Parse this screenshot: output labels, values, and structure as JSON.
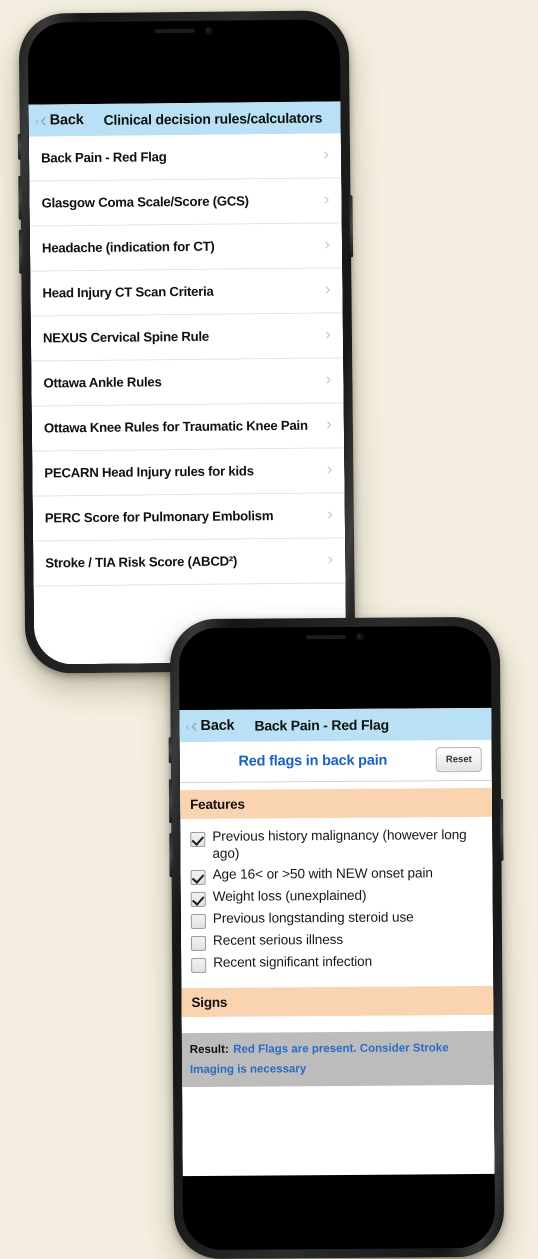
{
  "background_color": "#f4efe0",
  "accent_colors": {
    "navbar_blue": "#b9e0f5",
    "section_header_peach": "#fad3b0",
    "title_blue": "#1a5fc4",
    "result_bar_gray": "#bcbcbc",
    "result_text_blue": "#2a6ac4"
  },
  "phone1": {
    "navbar": {
      "back_label": "Back",
      "back_chevron_icon": "chevron-left-icon",
      "title": "Clinical decision rules/calculators"
    },
    "list": [
      {
        "label": "Back Pain - Red Flag",
        "chevron_icon": "chevron-right-icon"
      },
      {
        "label": "Glasgow Coma Scale/Score (GCS)",
        "chevron_icon": "chevron-right-icon"
      },
      {
        "label": "Headache (indication for CT)",
        "chevron_icon": "chevron-right-icon"
      },
      {
        "label": "Head Injury CT Scan Criteria",
        "chevron_icon": "chevron-right-icon"
      },
      {
        "label": "NEXUS Cervical Spine Rule",
        "chevron_icon": "chevron-right-icon"
      },
      {
        "label": "Ottawa Ankle Rules",
        "chevron_icon": "chevron-right-icon"
      },
      {
        "label": "Ottawa Knee Rules for Traumatic Knee Pain",
        "chevron_icon": "chevron-right-icon"
      },
      {
        "label": "PECARN Head Injury rules for kids",
        "chevron_icon": "chevron-right-icon"
      },
      {
        "label": "PERC Score for Pulmonary Embolism",
        "chevron_icon": "chevron-right-icon"
      },
      {
        "label": "Stroke / TIA Risk Score (ABCD²)",
        "chevron_icon": "chevron-right-icon"
      }
    ]
  },
  "phone2": {
    "navbar": {
      "back_label": "Back",
      "back_chevron_icon": "chevron-left-icon",
      "title": "Back Pain - Red Flag"
    },
    "calculator": {
      "title": "Red flags in back pain",
      "reset_label": "Reset"
    },
    "sections": [
      {
        "header": "Features",
        "items": [
          {
            "label": "Previous history malignancy (however long ago)",
            "checked": true
          },
          {
            "label": "Age 16< or >50 with NEW onset pain",
            "checked": true
          },
          {
            "label": "Weight loss (unexplained)",
            "checked": true
          },
          {
            "label": "Previous longstanding steroid use",
            "checked": false
          },
          {
            "label": "Recent serious illness",
            "checked": false
          },
          {
            "label": "Recent significant infection",
            "checked": false
          }
        ]
      },
      {
        "header": "Signs",
        "items": []
      }
    ],
    "result": {
      "key": "Result:",
      "value": "Red Flags are present. Consider Stroke Imaging is necessary"
    }
  }
}
